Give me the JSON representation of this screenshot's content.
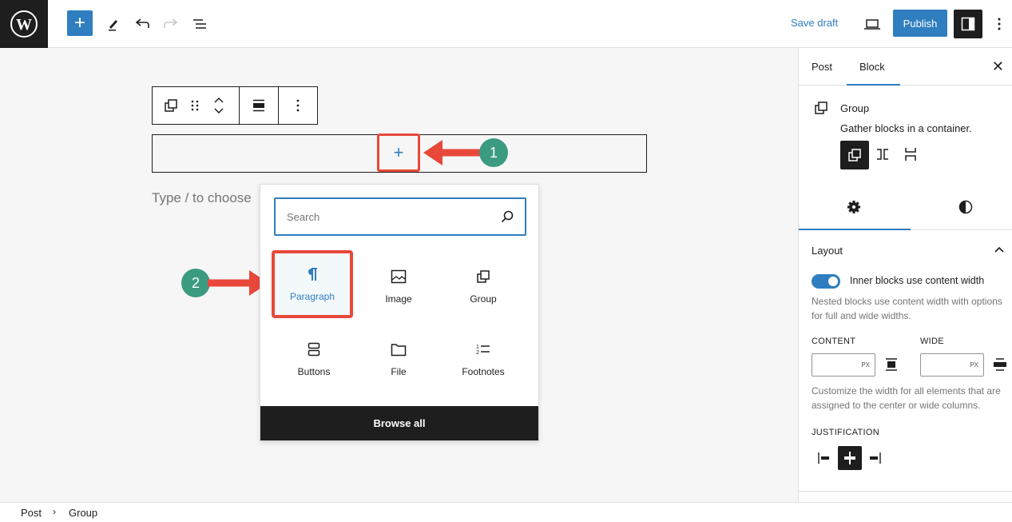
{
  "topbar": {
    "save_draft": "Save draft",
    "publish": "Publish",
    "add_block": "+"
  },
  "canvas": {
    "appender": "+",
    "placeholder": "Type / to choose"
  },
  "inserter": {
    "search_placeholder": "Search",
    "blocks": [
      {
        "label": "Paragraph",
        "icon": "paragraph-icon",
        "selected": true
      },
      {
        "label": "Image",
        "icon": "image-icon"
      },
      {
        "label": "Group",
        "icon": "group-icon"
      },
      {
        "label": "Buttons",
        "icon": "buttons-icon"
      },
      {
        "label": "File",
        "icon": "file-icon"
      },
      {
        "label": "Footnotes",
        "icon": "footnotes-icon"
      }
    ],
    "browse_all": "Browse all"
  },
  "annotations": {
    "step1": "1",
    "step2": "2",
    "color": "#e8483a",
    "badge_color": "#3a9b80"
  },
  "sidebar": {
    "tabs": [
      "Post",
      "Block"
    ],
    "active_tab": "Block",
    "block_name": "Group",
    "block_desc": "Gather blocks in a container.",
    "layout": {
      "title": "Layout",
      "toggle_label": "Inner blocks use content width",
      "toggle_on": true,
      "help": "Nested blocks use content width with options for full and wide widths.",
      "content_label": "CONTENT",
      "wide_label": "WIDE",
      "unit": "PX",
      "width_help": "Customize the width for all elements that are assigned to the center or wide columns.",
      "justification_label": "JUSTIFICATION"
    }
  },
  "breadcrumb": [
    "Post",
    "Group"
  ],
  "colors": {
    "accent": "#2f7ebf",
    "dark": "#1e1e1e"
  }
}
